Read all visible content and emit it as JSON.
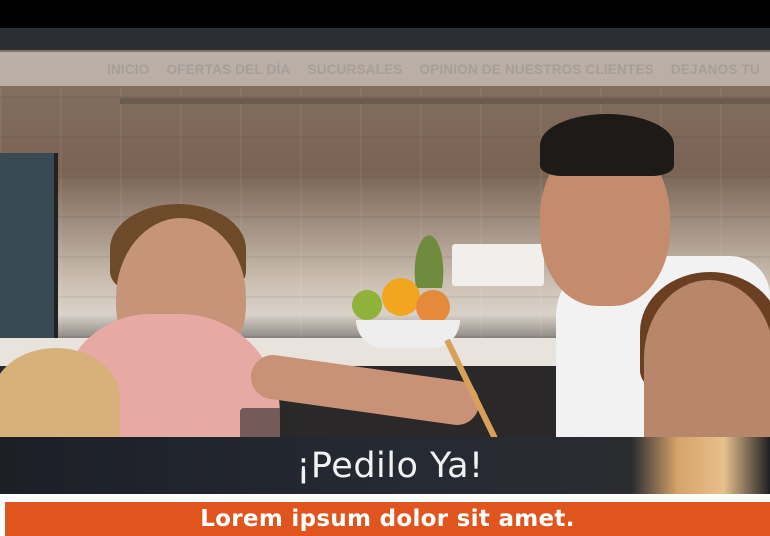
{
  "nav": {
    "items": [
      {
        "label": "INICIO"
      },
      {
        "label": "OFERTAS DEL DÍA"
      },
      {
        "label": "SUCURSALES"
      },
      {
        "label": "OPINION DE NUESTROS CLIENTES"
      },
      {
        "label": "DEJANOS TU"
      }
    ]
  },
  "hero": {
    "image": "family-cooking-kitchen-photo"
  },
  "banner": {
    "title": "¡Pedilo Ya!"
  },
  "promo": {
    "text": "Lorem ipsum dolor sit amet."
  },
  "colors": {
    "top_strip": "#000000",
    "nav_text": "#a79f97",
    "banner_bg": "#1c1f26",
    "promo_bg": "#e0541d",
    "promo_text": "#ffffff"
  }
}
